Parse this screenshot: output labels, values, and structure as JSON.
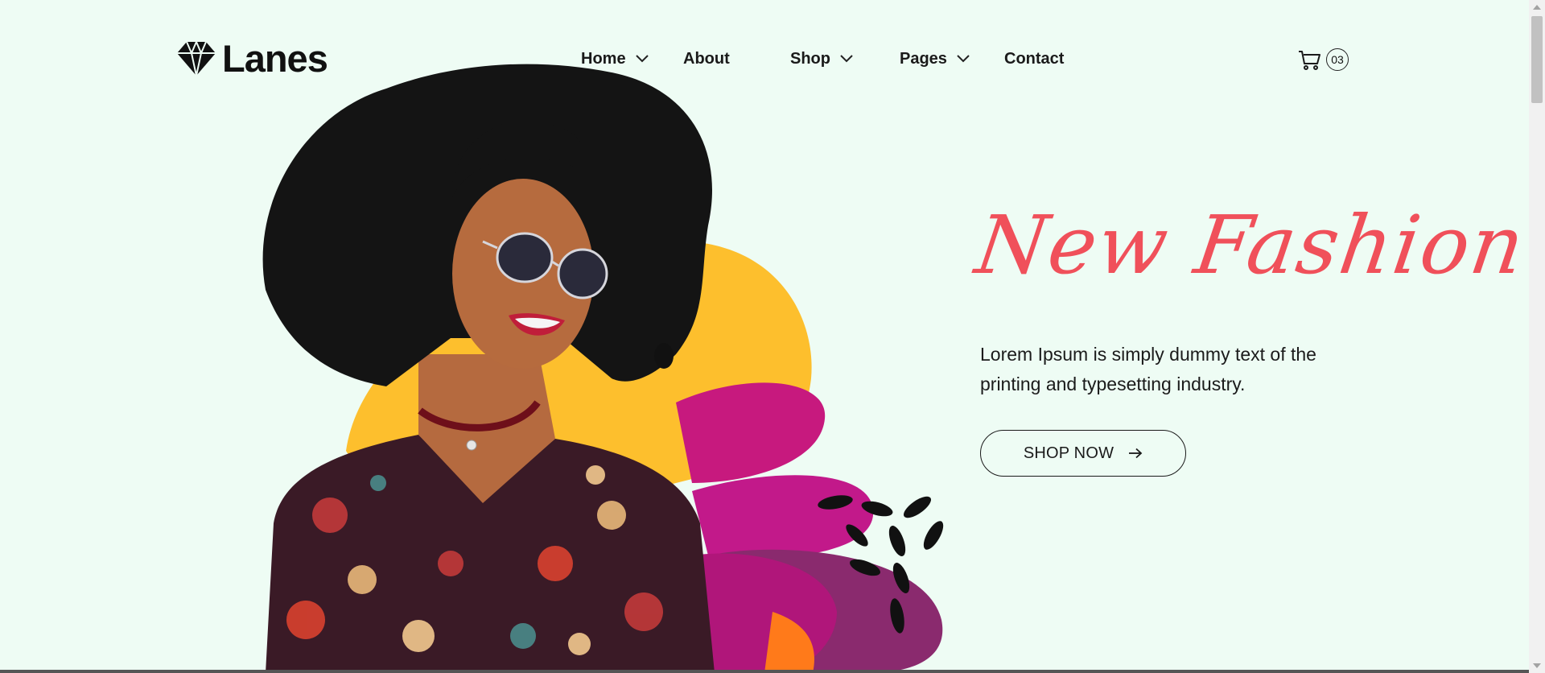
{
  "brand": {
    "name": "Lanes",
    "icon": "diamond-logo-icon"
  },
  "nav": {
    "items": [
      {
        "label": "Home",
        "has_dropdown": true
      },
      {
        "label": "About",
        "has_dropdown": false
      },
      {
        "label": "Shop",
        "has_dropdown": true
      },
      {
        "label": "Pages",
        "has_dropdown": true
      },
      {
        "label": "Contact",
        "has_dropdown": false
      }
    ]
  },
  "cart": {
    "icon": "cart-icon",
    "count": "03"
  },
  "hero": {
    "headline": "New Fashion",
    "description": "Lorem Ipsum is simply dummy text of the printing and typesetting industry.",
    "cta_label": "SHOP NOW",
    "cta_icon": "arrow-right-icon",
    "image": "model-with-sunglasses-and-floral-blouse"
  },
  "colors": {
    "background": "#eefcf4",
    "accent": "#f0505a",
    "blob_yellow": "#fdbf2d",
    "blob_magenta": "#c7197e",
    "blob_purple": "#8a2a6e",
    "blob_orange": "#ff7a1a"
  }
}
